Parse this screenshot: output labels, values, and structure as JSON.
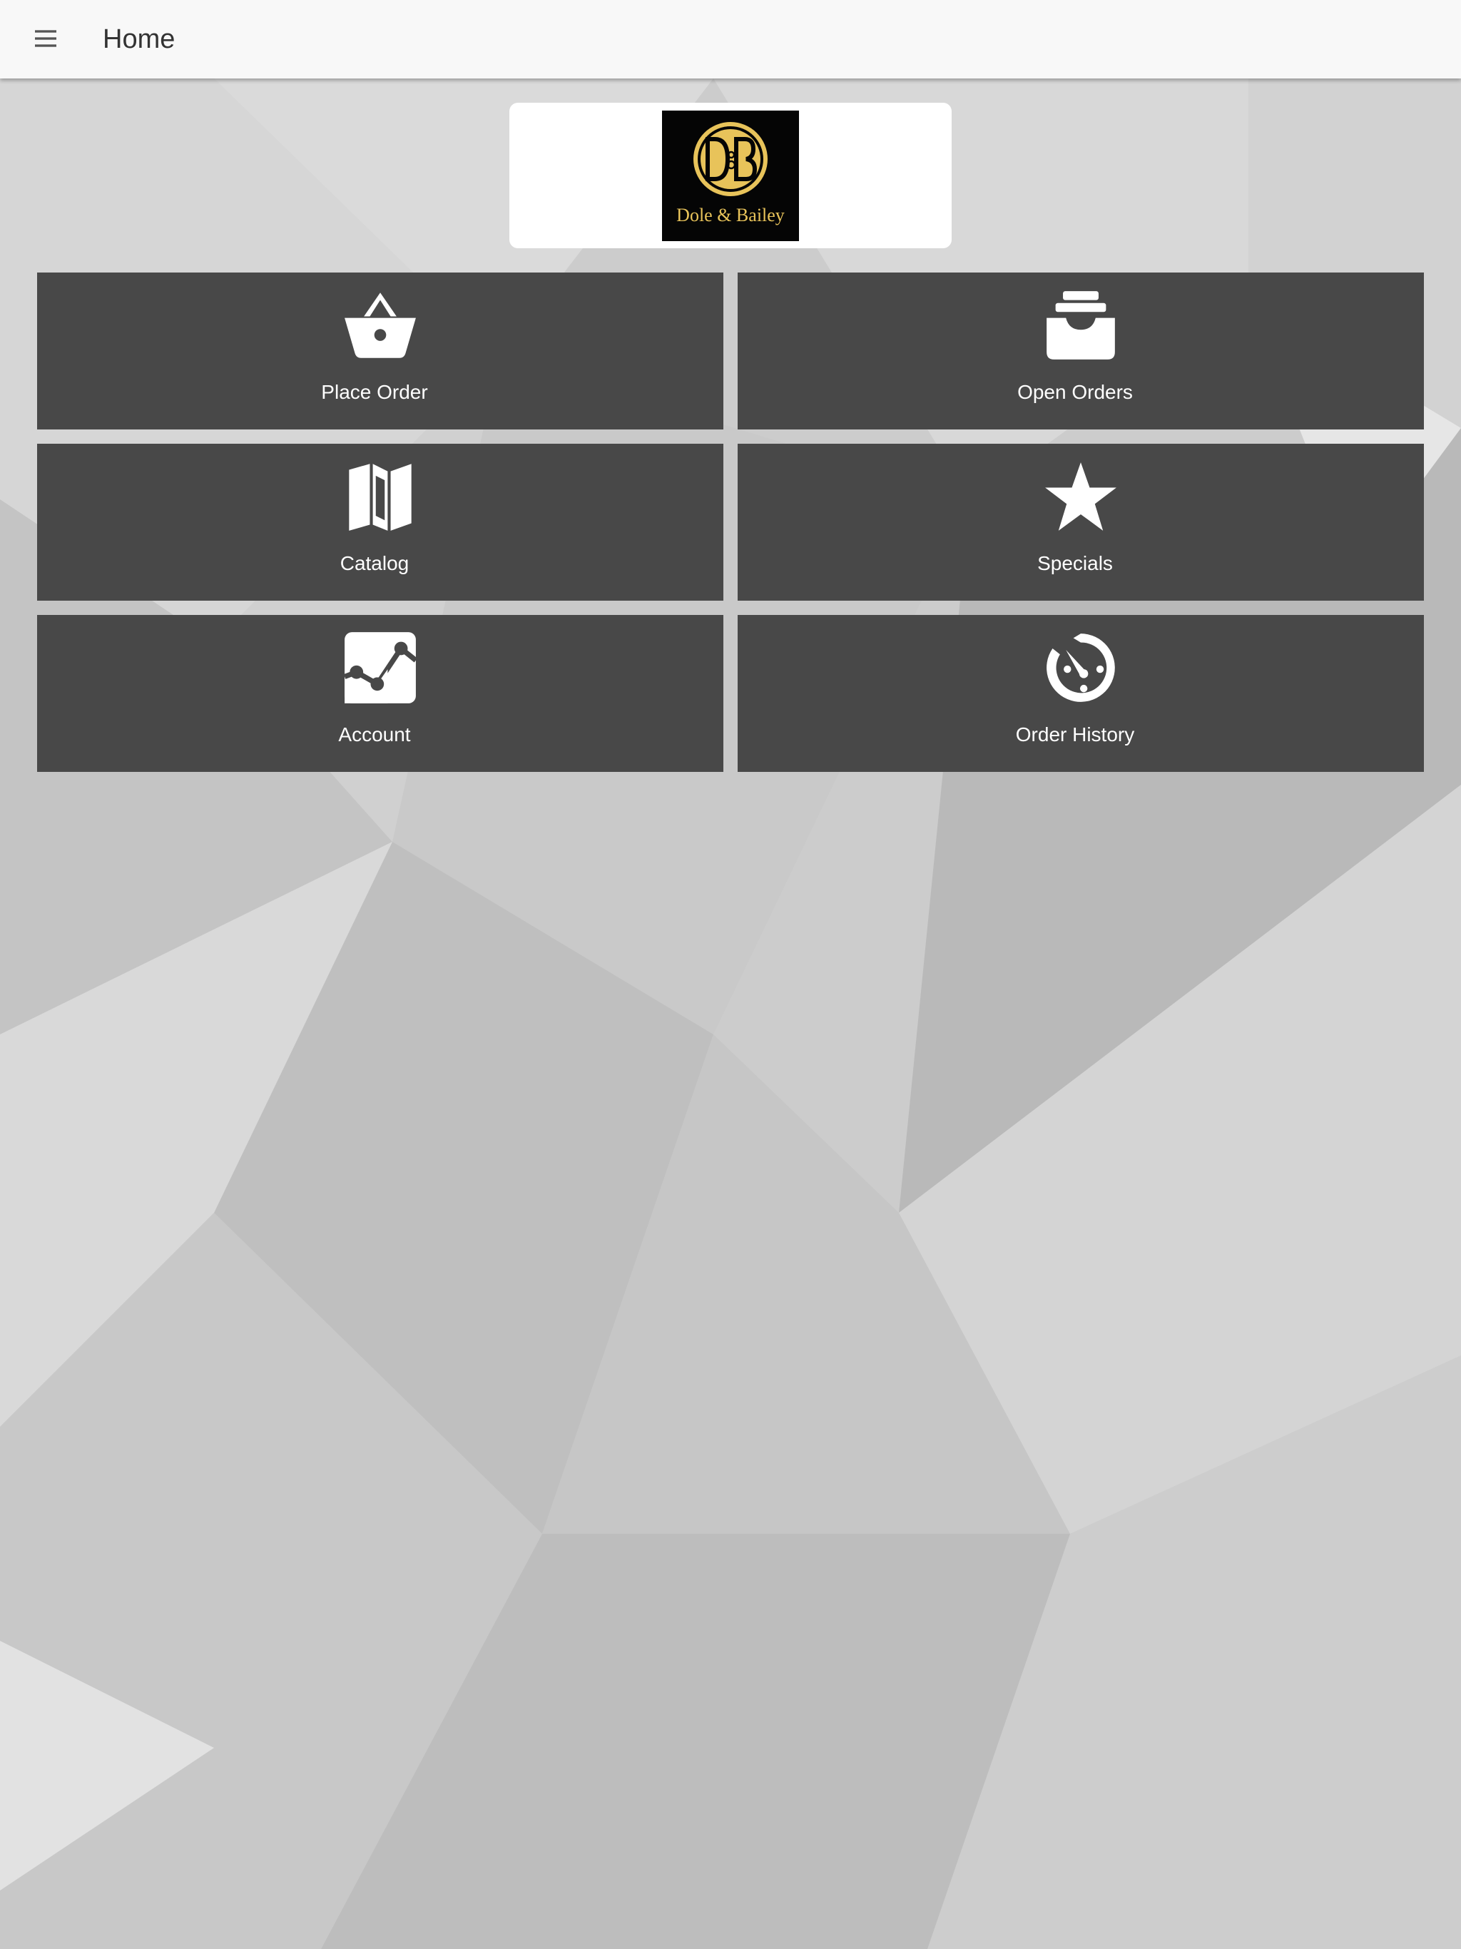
{
  "header": {
    "title": "Home",
    "menu_icon": "hamburger-menu-icon"
  },
  "logo": {
    "monogram": "D&B",
    "brand_name": "Dole & Bailey",
    "background_color": "#050505",
    "accent_color": "#e8c35a"
  },
  "tiles": [
    {
      "label": "Place Order",
      "icon": "basket-icon"
    },
    {
      "label": "Open Orders",
      "icon": "inbox-tray-icon"
    },
    {
      "label": "Catalog",
      "icon": "folded-map-icon"
    },
    {
      "label": "Specials",
      "icon": "star-icon"
    },
    {
      "label": "Account",
      "icon": "line-chart-icon"
    },
    {
      "label": "Order History",
      "icon": "clock-history-icon"
    }
  ],
  "colors": {
    "appbar": "#f8f8f8",
    "tile": "#484848",
    "tile_text": "#ffffff",
    "title_text": "#333333",
    "background": "#cfcfcf"
  }
}
